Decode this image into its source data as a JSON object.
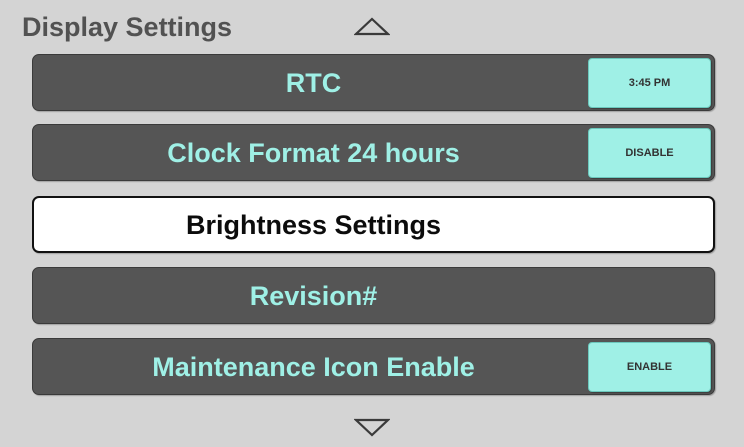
{
  "header": {
    "title": "Display Settings"
  },
  "nav": {
    "up_icon": "triangle-up-icon",
    "down_icon": "triangle-down-icon"
  },
  "colors": {
    "background": "#d4d4d4",
    "row_background": "#555555",
    "row_text": "#9ff0e6",
    "button_background": "#9ff0e6",
    "selected_background": "#ffffff",
    "title_text": "#525252"
  },
  "menu": {
    "items": [
      {
        "label": "RTC",
        "value": "3:45 PM"
      },
      {
        "label": "Clock Format 24 hours",
        "value": "DISABLE"
      },
      {
        "label": "Brightness Settings",
        "selected": true
      },
      {
        "label": "Revision#"
      },
      {
        "label": "Maintenance Icon Enable",
        "value": "ENABLE"
      }
    ]
  }
}
